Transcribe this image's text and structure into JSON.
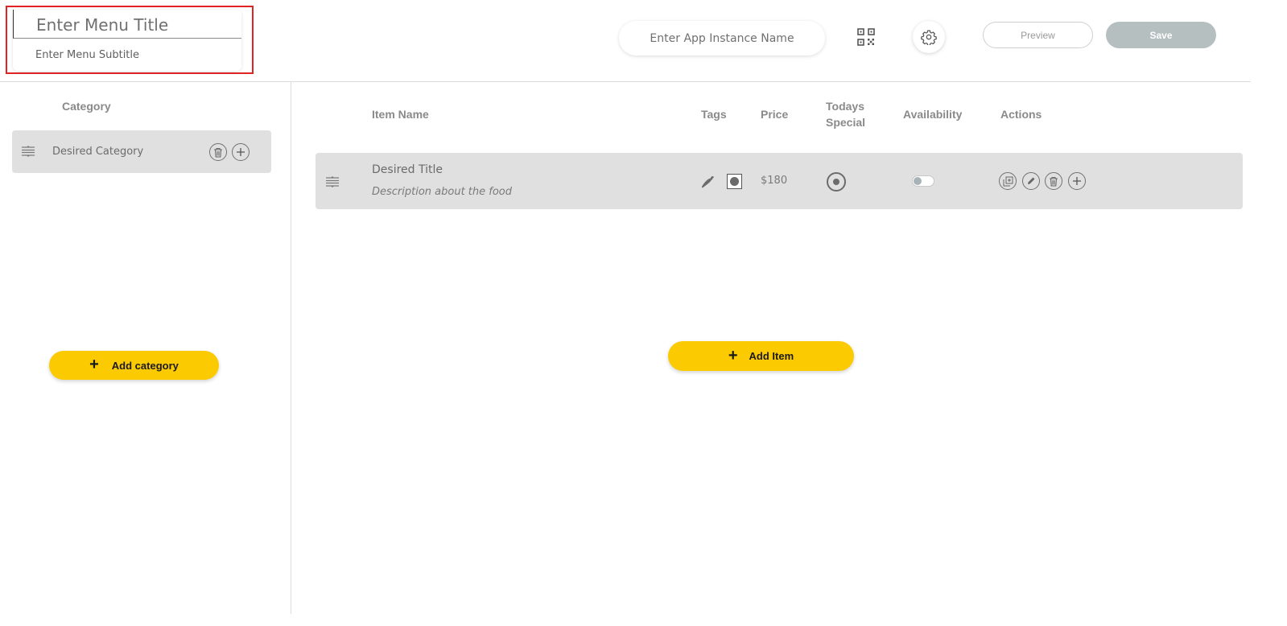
{
  "header": {
    "menu_title_placeholder": "Enter Menu Title",
    "menu_subtitle_placeholder": "Enter Menu Subtitle",
    "app_instance_placeholder": "Enter App Instance Name",
    "preview_label": "Preview",
    "save_label": "Save",
    "qr_icon": "qr-code-icon",
    "settings_icon": "gear-icon"
  },
  "categories": {
    "header": "Category",
    "items": [
      {
        "label": "Desired Category"
      }
    ],
    "add_label": "Add category"
  },
  "items_table": {
    "columns": {
      "item_name": "Item Name",
      "tags": "Tags",
      "price": "Price",
      "todays_special_line1": "Todays",
      "todays_special_line2": "Special",
      "availability": "Availability",
      "actions": "Actions"
    },
    "rows": [
      {
        "title": "Desired Title",
        "description": "Description about the food",
        "tags": [
          "chili-pepper-icon",
          "veg-mark-icon"
        ],
        "price": "$180",
        "todays_special": true,
        "available": false
      }
    ],
    "add_label": "Add Item"
  },
  "colors": {
    "accent_yellow": "#fcca00",
    "row_background": "#e0e0e0",
    "save_disabled": "#b5bfbf",
    "highlight_border": "#e02424"
  }
}
